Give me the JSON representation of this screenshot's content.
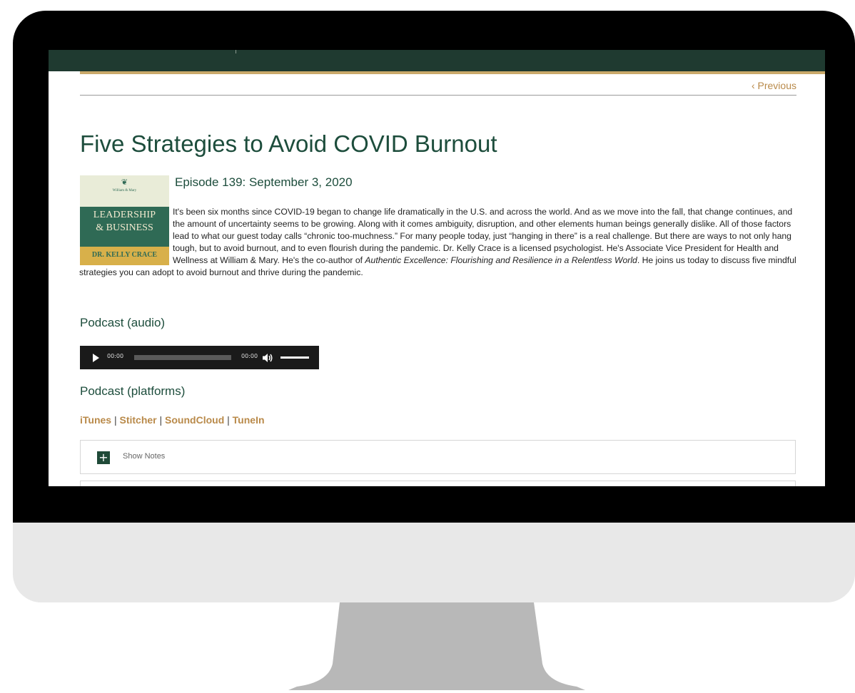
{
  "colors": {
    "header_green": "#1f3a30",
    "accent_gold": "#c9a96a",
    "title_green": "#1d4d3c",
    "link_gold": "#b98a4a",
    "monitor_bezel": "#000000",
    "monitor_chin": "#e8e8e8",
    "monitor_stand": "#b8b8b8"
  },
  "nav": {
    "previous_label": "‹ Previous"
  },
  "article": {
    "title": "Five Strategies to Avoid COVID Burnout",
    "episode": "Episode 139: September 3, 2020",
    "cover_art": {
      "title_line1": "LEADERSHIP",
      "title_line2": "& BUSINESS",
      "host": "DR. KELLY CRACE",
      "crest_icon": "cypher-crest-icon",
      "crest_text": "William & Mary"
    },
    "description_part1": "It's been six months since COVID-19 began to change life dramatically in the U.S. and across the world. And as we move into the fall, that change continues, and the amount of uncertainty seems to be growing. Along with it comes ambiguity, disruption, and other elements human beings generally dislike. All of those factors lead to what our guest today calls “chronic too-muchness.” For many people today, just “hanging in there” is a real challenge. But there are ways to not only hang tough, but to avoid burnout, and to even flourish during the pandemic. Dr. Kelly Crace is a licensed psychologist. He's Associate Vice President for Health and Wellness at William & Mary. He's the co-author of ",
    "description_book": "Authentic Excellence: Flourishing and Resilience in a Relentless World",
    "description_part2": ". He joins us today to discuss five mindful strategies you can adopt to avoid burnout and thrive during the pandemic."
  },
  "audio_section": {
    "heading": "Podcast (audio)",
    "player": {
      "current_time": "00:00",
      "duration": "00:00",
      "progress": 0,
      "volume": 1.0,
      "play_icon": "play-icon",
      "volume_icon": "speaker-icon"
    }
  },
  "platforms_section": {
    "heading": "Podcast (platforms)",
    "links": [
      "iTunes",
      "Stitcher",
      "SoundCloud",
      "TuneIn"
    ],
    "separator": " | "
  },
  "accordion": {
    "show_notes_label": "Show Notes",
    "toggle_symbol": "+"
  }
}
